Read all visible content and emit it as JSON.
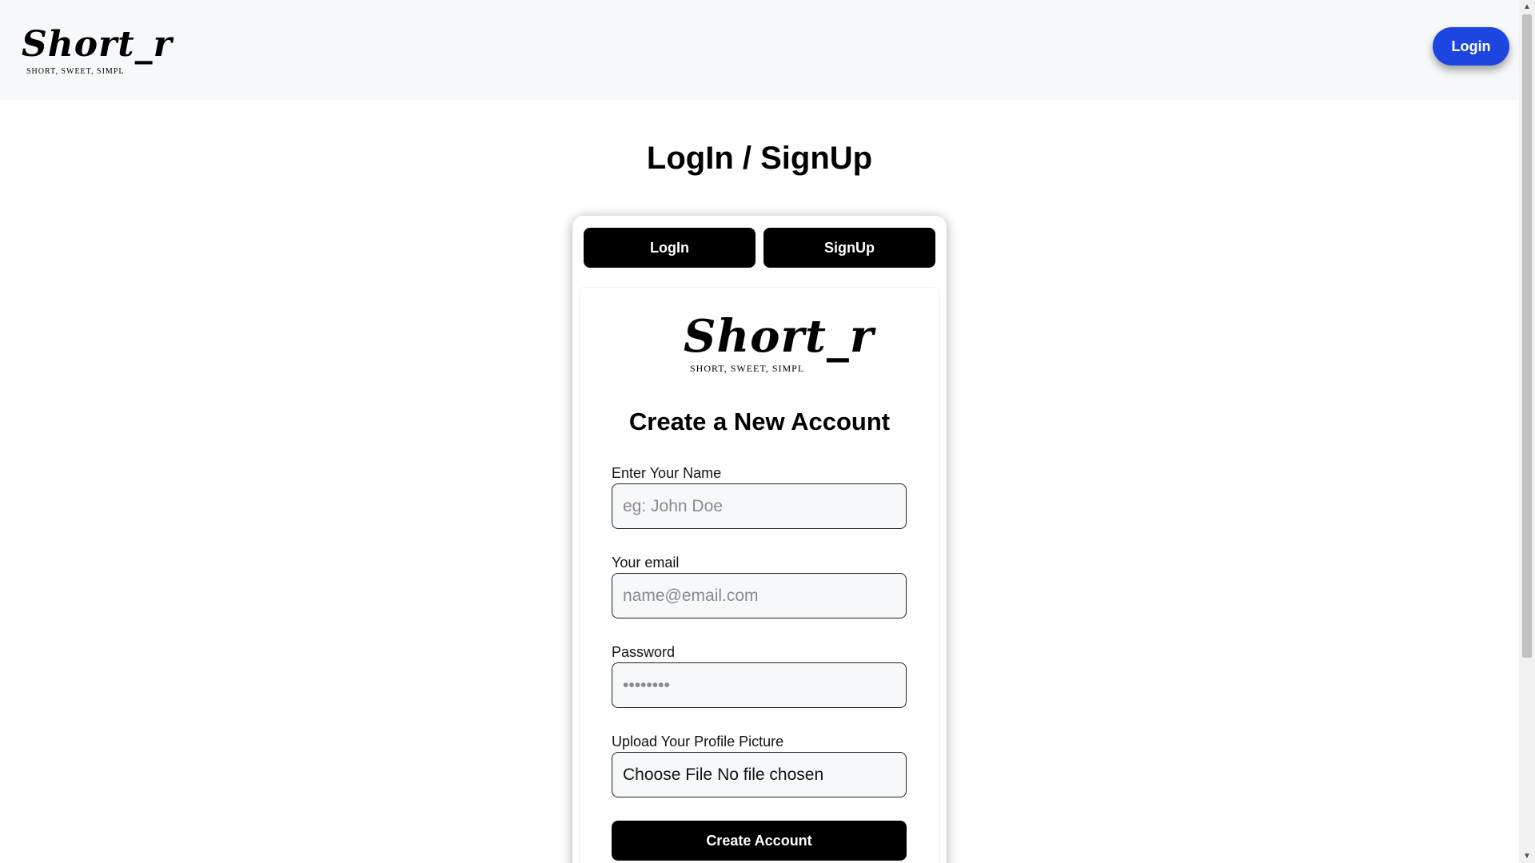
{
  "header": {
    "logo_text": "Short_r",
    "logo_tagline": "SHORT, SWEET, SIMPL",
    "login_button": "Login"
  },
  "page_title": "LogIn / SignUp",
  "tabs": [
    {
      "label": "LogIn"
    },
    {
      "label": "SignUp",
      "active": true
    }
  ],
  "form": {
    "logo_text": "Short_r",
    "logo_tagline": "SHORT, SWEET, SIMPL",
    "heading": "Create a New Account",
    "name": {
      "label": "Enter Your Name",
      "placeholder": "eg: John Doe",
      "value": ""
    },
    "email": {
      "label": "Your email",
      "placeholder": "name@email.com",
      "value": ""
    },
    "password": {
      "label": "Password",
      "placeholder": "••••••••",
      "value": ""
    },
    "picture": {
      "label": "Upload Your Profile Picture",
      "button": "Choose File",
      "status": "No file chosen"
    },
    "submit": "Create Account"
  },
  "colors": {
    "accent": "#1d46e0",
    "header_bg": "#f7f8fa",
    "button_bg": "#000000"
  }
}
